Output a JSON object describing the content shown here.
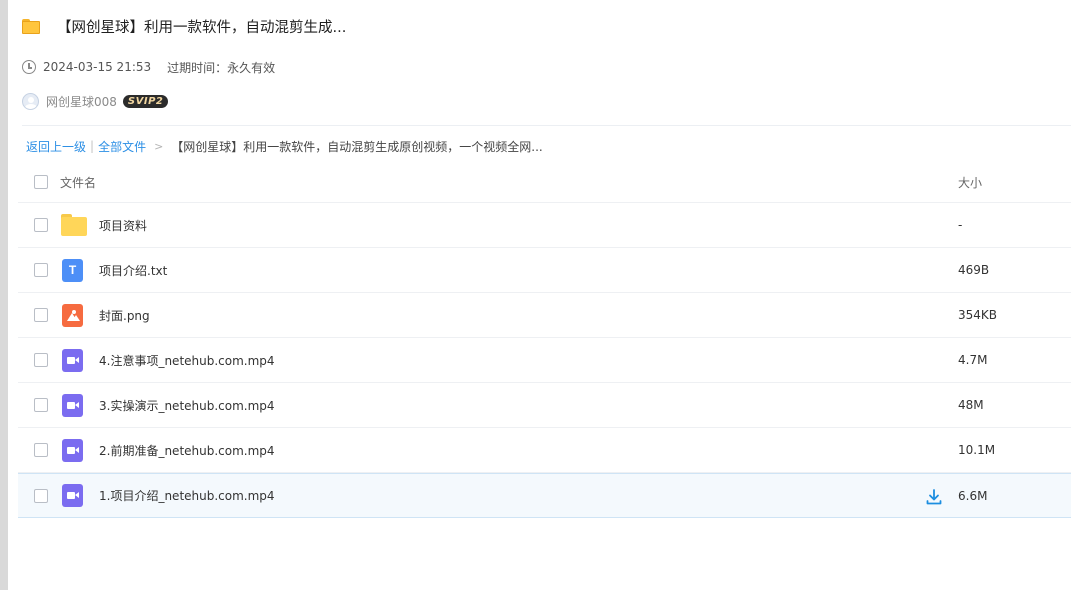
{
  "header": {
    "title": "【网创星球】利用一款软件，自动混剪生成...",
    "date": "2024-03-15 21:53",
    "expire_label": "过期时间：永久有效",
    "user_name": "网创星球008",
    "vip_badge": "SVIP2"
  },
  "breadcrumb": {
    "back": "返回上一级",
    "separator": "|",
    "all_files": "全部文件",
    "arrow": ">",
    "current": "【网创星球】利用一款软件，自动混剪生成原创视频，一个视频全网..."
  },
  "table": {
    "columns": {
      "name": "文件名",
      "size": "大小"
    },
    "rows": [
      {
        "name": "项目资料",
        "size": "-",
        "type": "folder-icon"
      },
      {
        "name": "项目介绍.txt",
        "size": "469B",
        "type": "txt-file-icon",
        "glyph": "T"
      },
      {
        "name": "封面.png",
        "size": "354KB",
        "type": "image-file-icon"
      },
      {
        "name": "4.注意事项_netehub.com.mp4",
        "size": "4.7M",
        "type": "video-file-icon"
      },
      {
        "name": "3.实操演示_netehub.com.mp4",
        "size": "48M",
        "type": "video-file-icon"
      },
      {
        "name": "2.前期准备_netehub.com.mp4",
        "size": "10.1M",
        "type": "video-file-icon"
      },
      {
        "name": "1.项目介绍_netehub.com.mp4",
        "size": "6.6M",
        "type": "video-file-icon"
      }
    ]
  },
  "colors": {
    "link": "#2c8fe5",
    "folder": "#ffd659",
    "txt": "#4d8ff7",
    "image": "#f66b40",
    "video": "#7b6cf0",
    "hover_row": "#f4f9fd",
    "download_icon": "#1c8ee0"
  }
}
